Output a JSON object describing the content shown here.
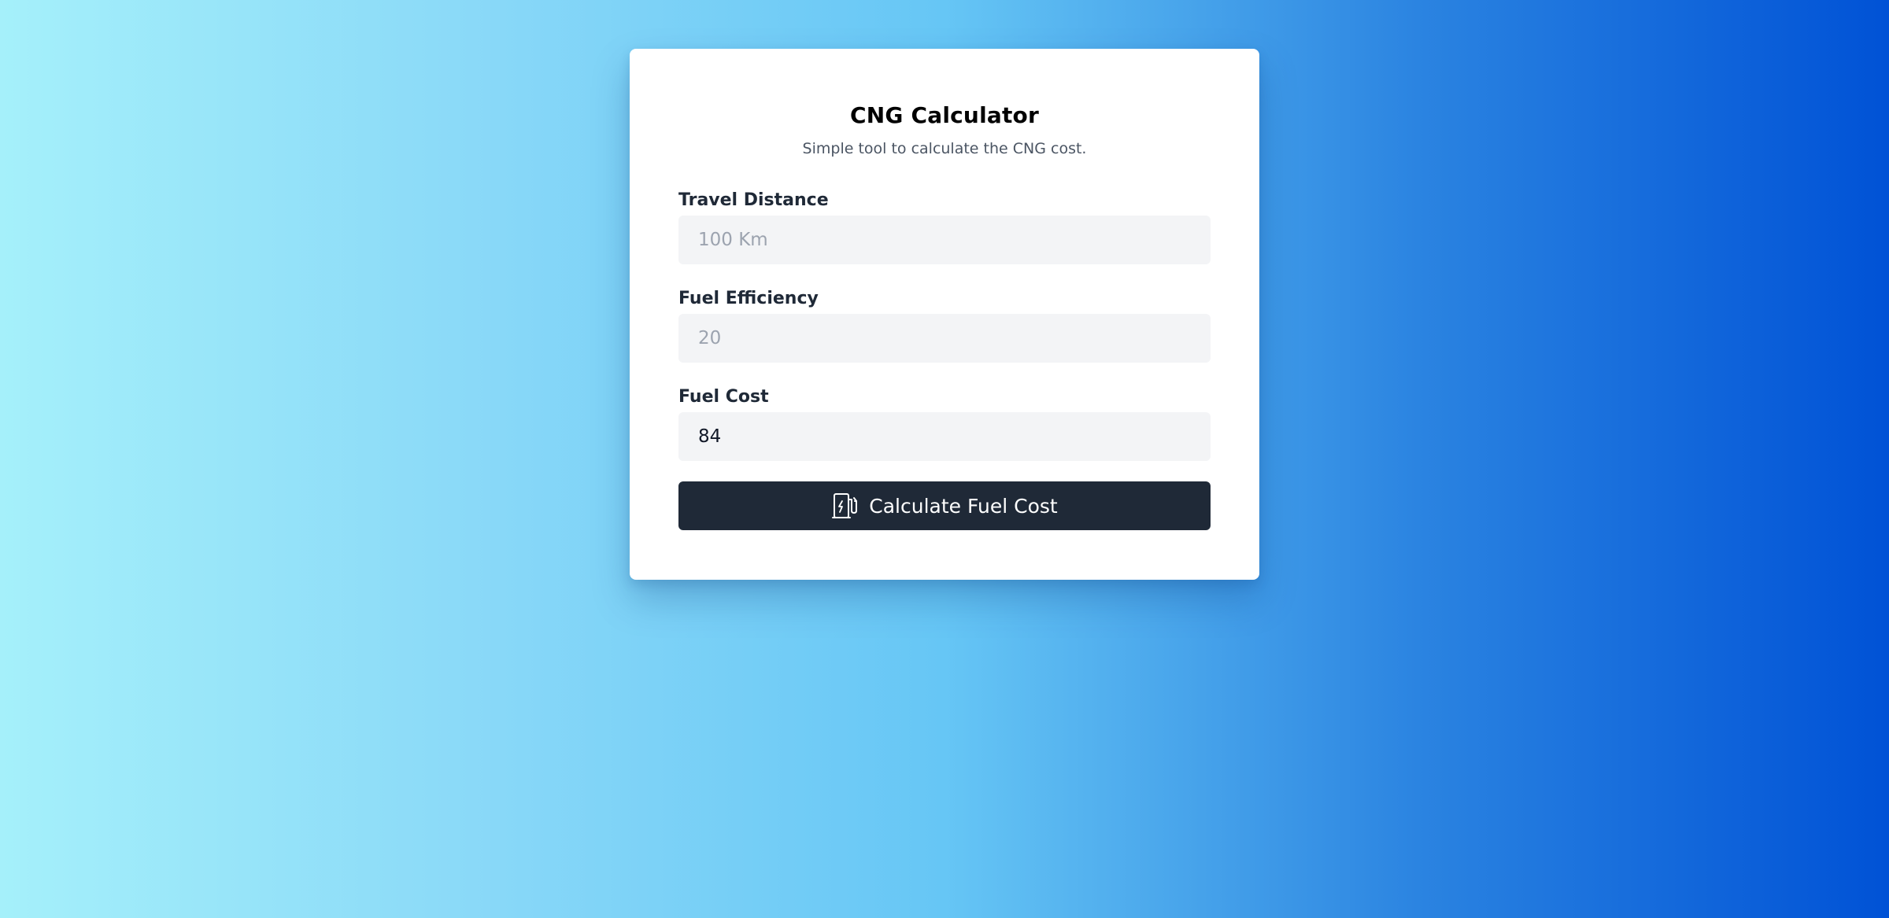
{
  "card": {
    "title": "CNG Calculator",
    "subtitle": "Simple tool to calculate the CNG cost."
  },
  "fields": {
    "travel_distance": {
      "label": "Travel Distance",
      "value": "",
      "placeholder": "100 Km"
    },
    "fuel_efficiency": {
      "label": "Fuel Efficiency",
      "value": "",
      "placeholder": "20"
    },
    "fuel_cost": {
      "label": "Fuel Cost",
      "value": "84",
      "placeholder": ""
    }
  },
  "button": {
    "label": "Calculate Fuel Cost",
    "icon": "fuel-pump-icon"
  },
  "colors": {
    "button_bg": "#1f2937",
    "input_bg": "#f3f4f6",
    "gradient_start": "#a5f0fa",
    "gradient_end": "#0052d6"
  }
}
